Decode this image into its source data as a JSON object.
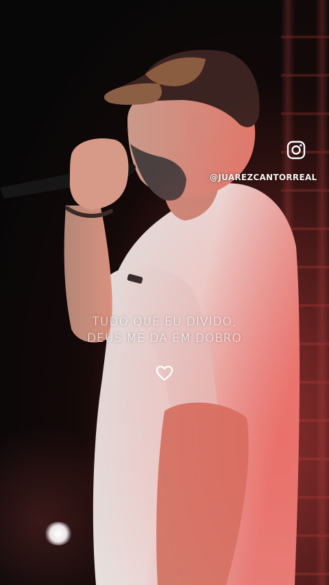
{
  "story": {
    "handle": "@JUAREZCANTORREAL",
    "lyrics": [
      "TUDO QUE EU DIVIDO,",
      "DEUS ME DA EM DOBRO"
    ],
    "icons": {
      "social": "instagram-icon",
      "reaction": "heart-icon"
    }
  },
  "colors": {
    "text": "#ffffff",
    "shirt": "#e9e2e0",
    "warm_light": "#e8504e",
    "background": "#0a0a0c"
  }
}
